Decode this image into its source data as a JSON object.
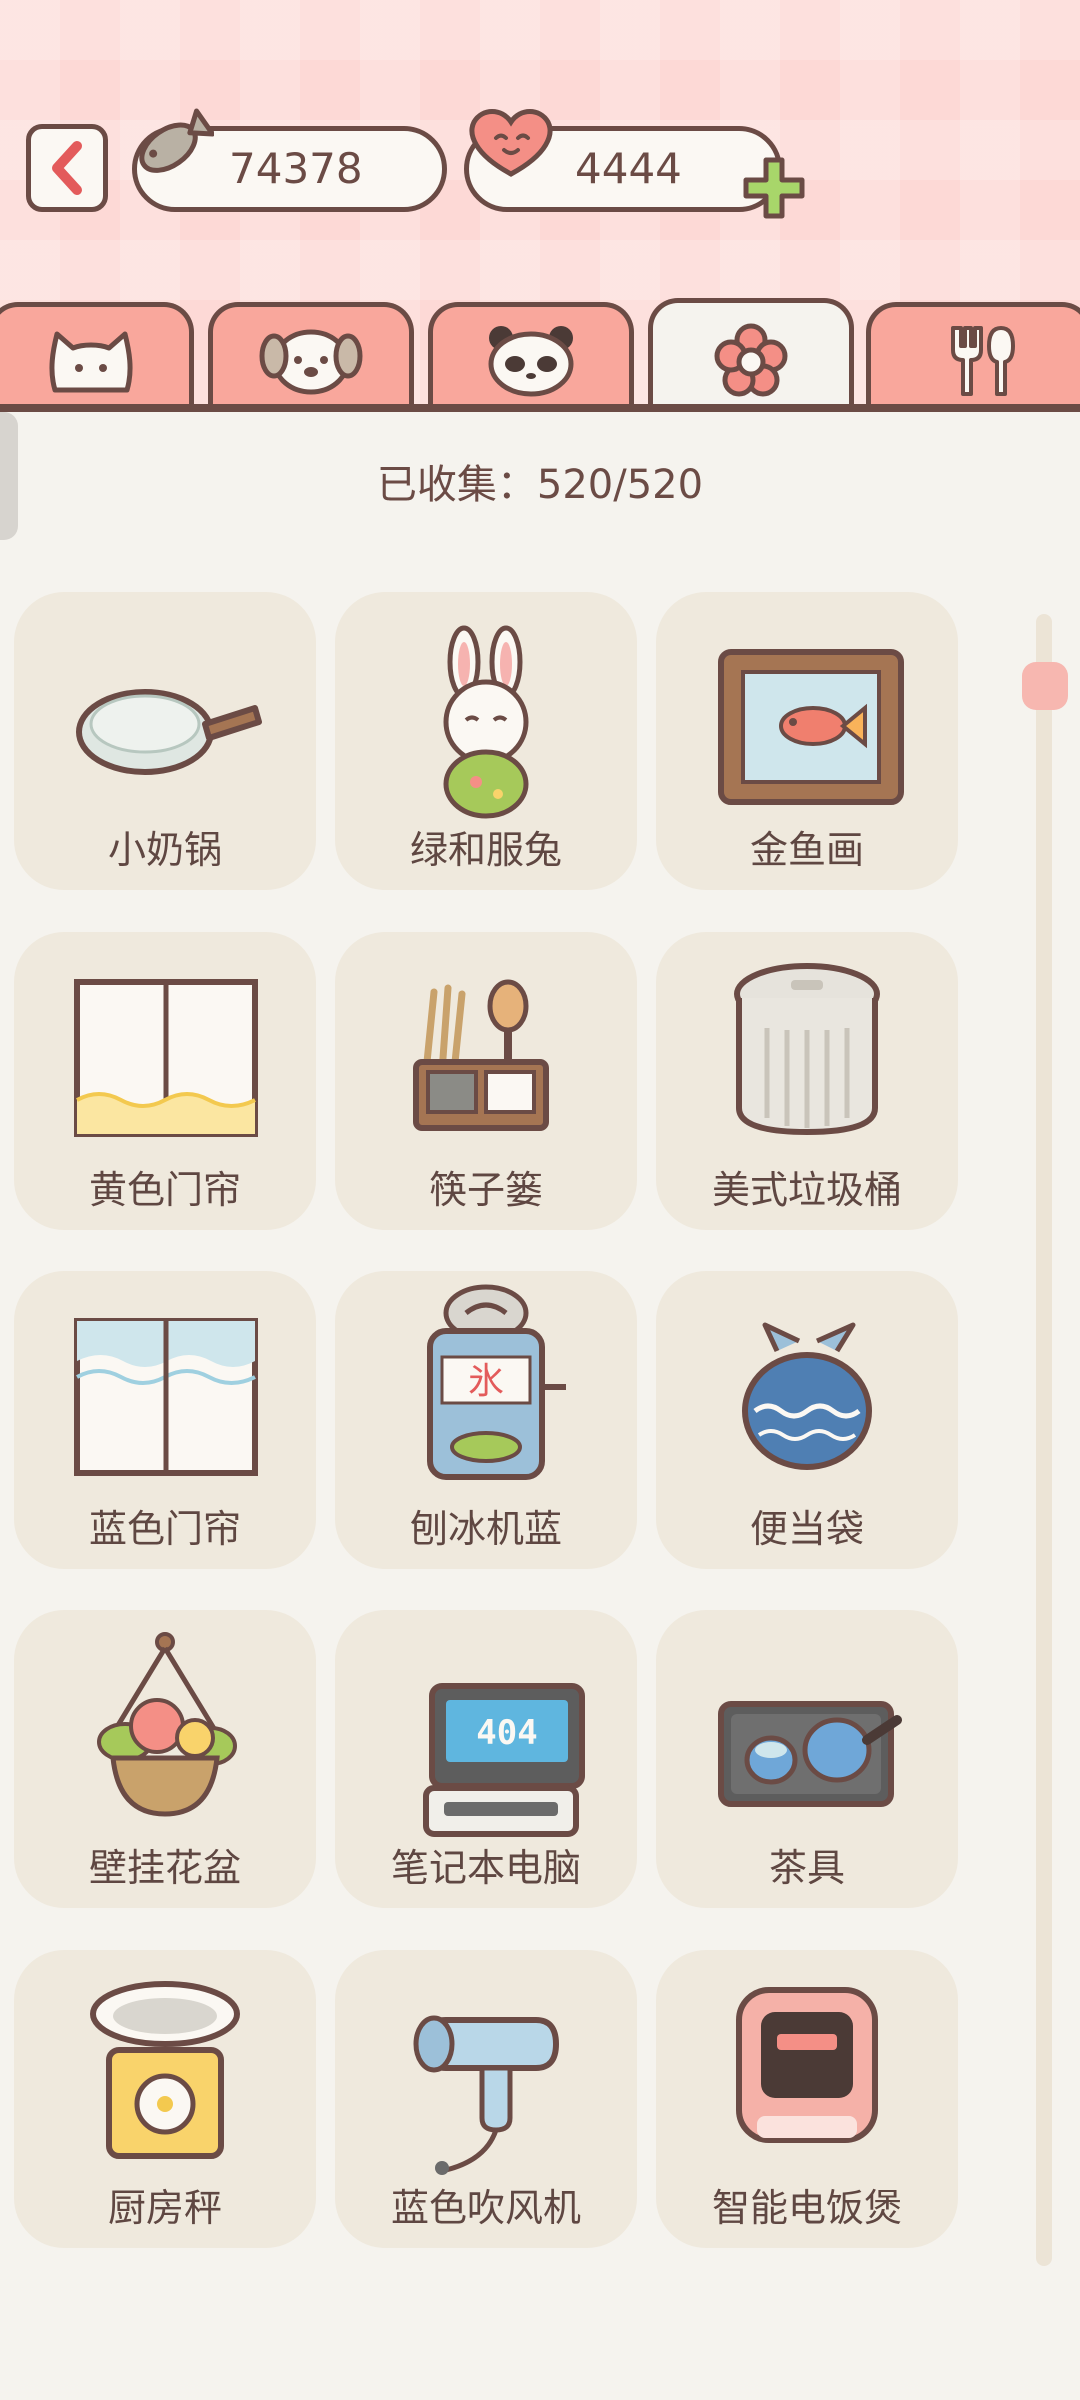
{
  "header": {
    "back_label": "‹",
    "fish_currency": "74378",
    "heart_currency": "4444",
    "add_label": "+"
  },
  "tabs": [
    {
      "icon": "cat-icon",
      "active": false
    },
    {
      "icon": "dog-icon",
      "active": false
    },
    {
      "icon": "panda-icon",
      "active": false
    },
    {
      "icon": "flower-icon",
      "active": true
    },
    {
      "icon": "fork-spoon-icon",
      "active": false
    }
  ],
  "collection": {
    "text": "已收集：520/520"
  },
  "items": [
    {
      "label": "小奶锅",
      "icon": "milk-pan-icon"
    },
    {
      "label": "绿和服兔",
      "icon": "green-kimono-rabbit-icon"
    },
    {
      "label": "金鱼画",
      "icon": "goldfish-painting-icon"
    },
    {
      "label": "黄色门帘",
      "icon": "yellow-curtain-icon"
    },
    {
      "label": "筷子篓",
      "icon": "chopstick-holder-icon"
    },
    {
      "label": "美式垃圾桶",
      "icon": "trash-can-icon"
    },
    {
      "label": "蓝色门帘",
      "icon": "blue-curtain-icon"
    },
    {
      "label": "刨冰机蓝",
      "icon": "shaved-ice-machine-icon"
    },
    {
      "label": "便当袋",
      "icon": "bento-bag-icon"
    },
    {
      "label": "壁挂花盆",
      "icon": "hanging-flower-pot-icon"
    },
    {
      "label": "笔记本电脑",
      "icon": "laptop-icon"
    },
    {
      "label": "茶具",
      "icon": "tea-set-icon"
    },
    {
      "label": "厨房秤",
      "icon": "kitchen-scale-icon"
    },
    {
      "label": "蓝色吹风机",
      "icon": "blue-hair-dryer-icon"
    },
    {
      "label": "智能电饭煲",
      "icon": "rice-cooker-icon"
    }
  ],
  "laptop_screen_text": "404",
  "ice_machine_text": "氷",
  "colors": {
    "accent_pink": "#f9a79c",
    "outline": "#6b4b45",
    "background": "#f5f3ee",
    "card": "#efe9dd",
    "plus_green": "#a8d66a"
  }
}
